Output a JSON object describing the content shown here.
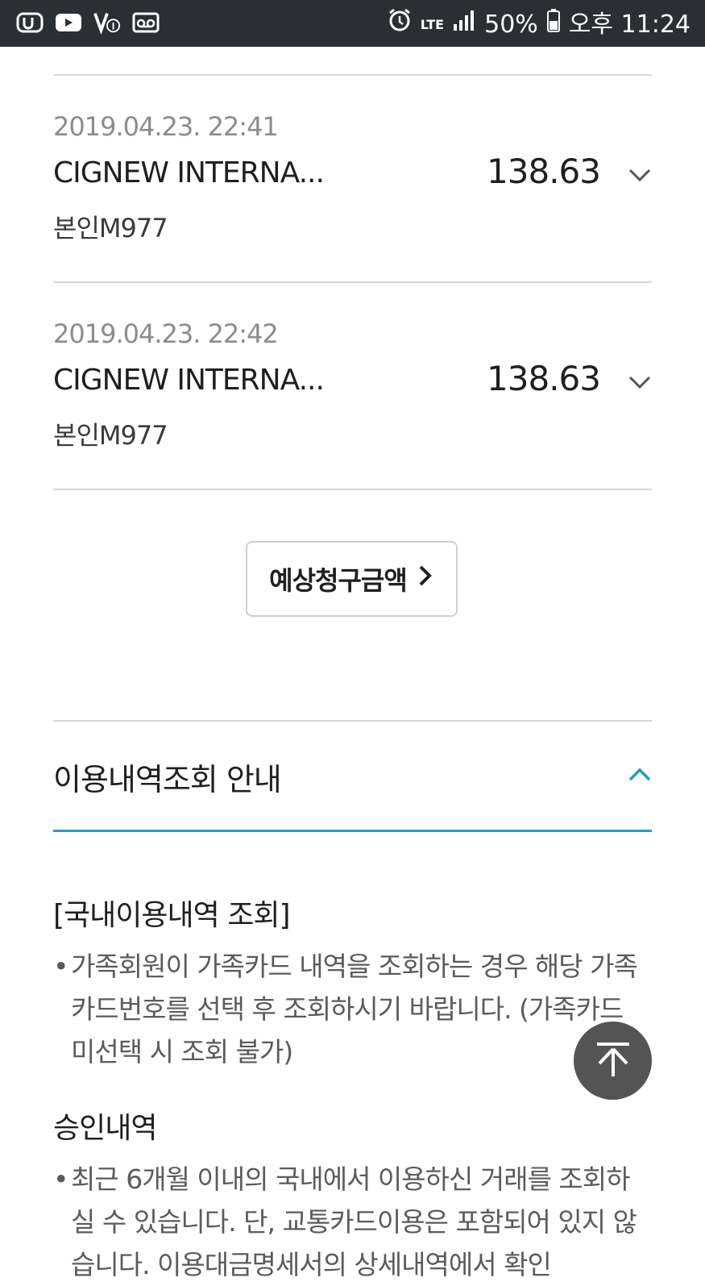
{
  "status_bar": {
    "left_icons": [
      "u-plus-icon",
      "youtube-icon",
      "v-one-icon",
      "voicemail-icon"
    ],
    "network": "LTE",
    "battery": "50%",
    "time": "오후 11:24"
  },
  "transactions": [
    {
      "date": "2019.04.23. 22:41",
      "merchant": "CIGNEW INTERNA...",
      "card": "본인M977",
      "amount": "138.63"
    },
    {
      "date": "2019.04.23. 22:42",
      "merchant": "CIGNEW INTERNA...",
      "card": "본인M977",
      "amount": "138.63"
    }
  ],
  "estimate_button": {
    "label": "예상청구금액"
  },
  "guide": {
    "title": "이용내역조회 안내",
    "accent_color": "#2a9bb8"
  },
  "sections": [
    {
      "title": "[국내이용내역 조회]",
      "bullets": [
        "가족회원이 가족카드 내역을 조회하는 경우 해당 가족 카드번호를 선택 후 조회하시기 바랍니다. (가족카드 미선택 시 조회 불가)"
      ]
    },
    {
      "title": "승인내역",
      "bullets": [
        "최근 6개월 이내의 국내에서 이용하신 거래를 조회하실 수 있습니다. 단, 교통카드이용은 포함되어 있지 않습니다. 이용대금명세서의 상세내역에서 확인"
      ]
    }
  ]
}
